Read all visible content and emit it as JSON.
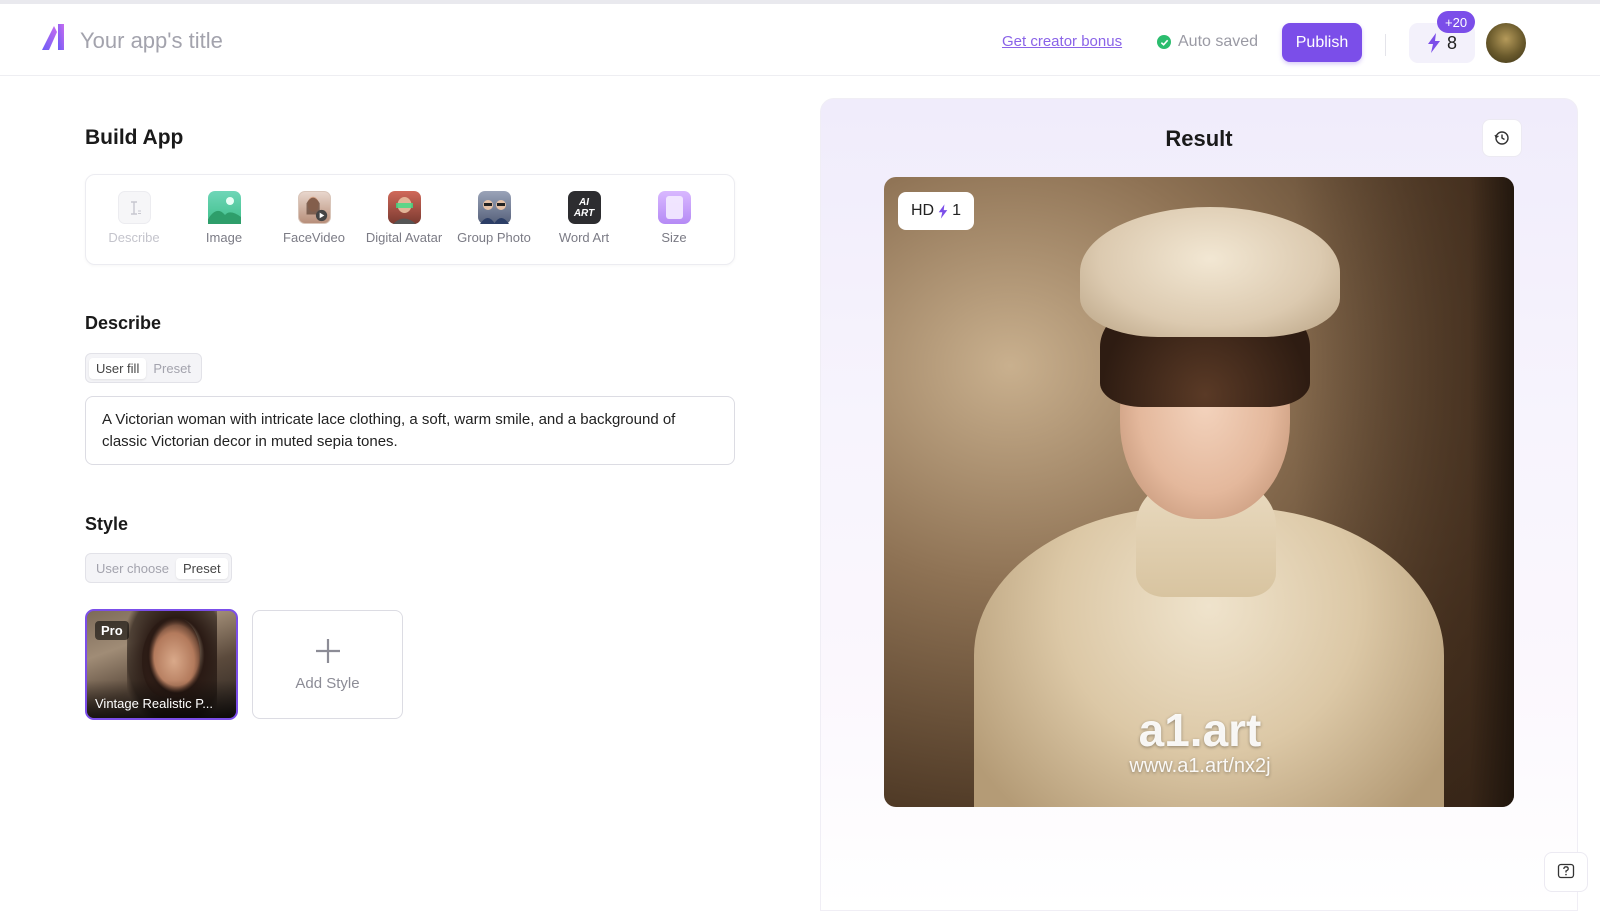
{
  "header": {
    "app_title": "Your app's title",
    "creator_bonus_link": "Get creator bonus",
    "auto_saved": "Auto saved",
    "publish_label": "Publish",
    "credits": "8",
    "bonus_badge": "+20"
  },
  "build": {
    "title": "Build App",
    "tools": [
      {
        "label": "Describe",
        "icon": "text-cursor-icon",
        "disabled": true
      },
      {
        "label": "Image",
        "icon": "image-icon"
      },
      {
        "label": "FaceVideo",
        "icon": "face-video-icon"
      },
      {
        "label": "Digital Avatar",
        "icon": "digital-avatar-icon"
      },
      {
        "label": "Group Photo",
        "icon": "group-photo-icon"
      },
      {
        "label": "Word Art",
        "icon": "word-art-icon"
      },
      {
        "label": "Size",
        "icon": "size-icon"
      }
    ],
    "word_art_icon_text": "AI ART"
  },
  "describe": {
    "title": "Describe",
    "toggle": [
      "User fill",
      "Preset"
    ],
    "toggle_active": "User fill",
    "prompt": "A Victorian woman with intricate lace clothing, a soft, warm smile, and a background of classic Victorian decor in muted sepia tones."
  },
  "style": {
    "title": "Style",
    "toggle": [
      "User choose",
      "Preset"
    ],
    "toggle_active": "Preset",
    "selected_style": {
      "tag": "Pro",
      "name": "Vintage Realistic P..."
    },
    "add_style_label": "Add Style"
  },
  "result": {
    "title": "Result",
    "hd_label": "HD",
    "hd_cost": "1",
    "watermark_brand": "a1.art",
    "watermark_url": "www.a1.art/nx2j"
  },
  "colors": {
    "accent": "#7b4ee9",
    "success": "#2bbd6e"
  }
}
